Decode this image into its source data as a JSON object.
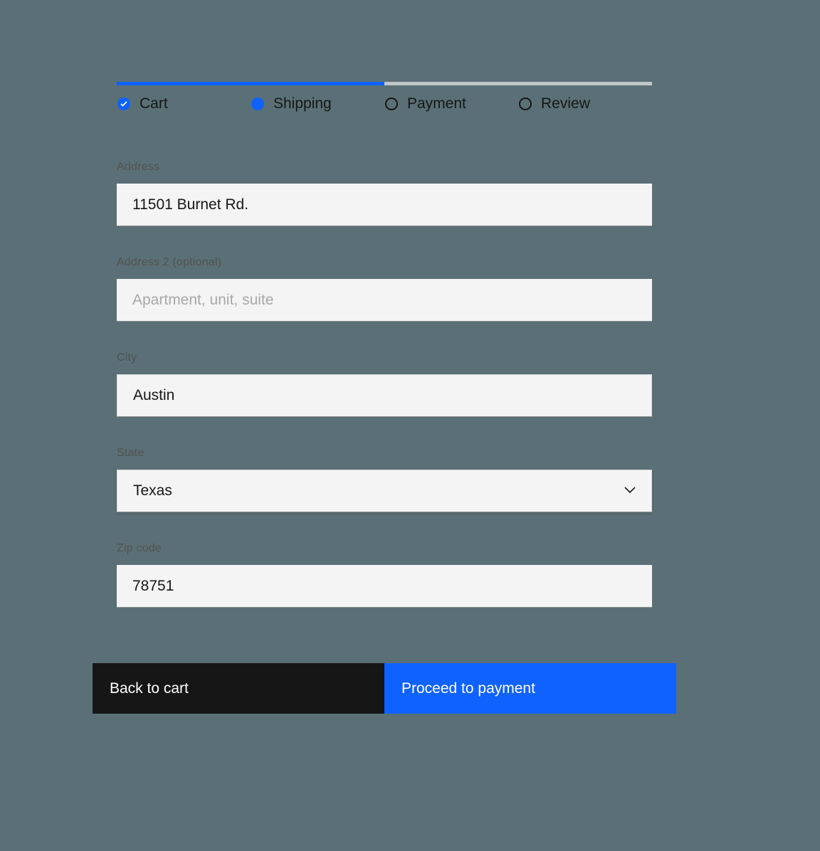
{
  "progress": {
    "steps": [
      {
        "label": "Cart",
        "state": "complete"
      },
      {
        "label": "Shipping",
        "state": "current"
      },
      {
        "label": "Payment",
        "state": "incomplete"
      },
      {
        "label": "Review",
        "state": "incomplete"
      }
    ],
    "percent": 50
  },
  "form": {
    "address": {
      "label": "Address",
      "value": "11501 Burnet Rd."
    },
    "address2": {
      "label": "Address 2 (optional)",
      "value": "",
      "placeholder": "Apartment, unit, suite"
    },
    "city": {
      "label": "City",
      "value": "Austin"
    },
    "state": {
      "label": "State",
      "value": "Texas"
    },
    "zip": {
      "label": "Zip code",
      "value": "78751"
    }
  },
  "buttons": {
    "back": "Back to cart",
    "proceed": "Proceed to payment"
  },
  "colors": {
    "accent": "#0f62fe",
    "secondary": "#161616",
    "field_bg": "#f4f4f4"
  }
}
